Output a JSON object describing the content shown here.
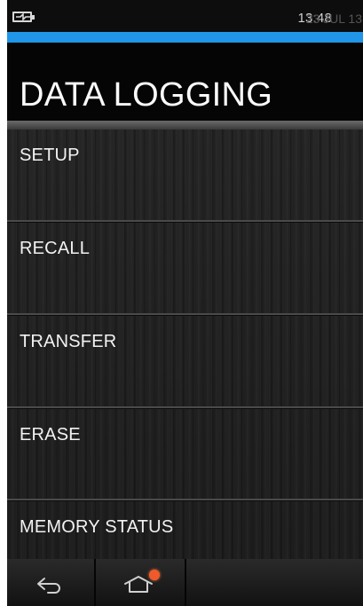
{
  "status_bar": {
    "battery_icon": "charging-battery-icon",
    "time": "13:48",
    "date": "23 JUL 13"
  },
  "colors": {
    "accent": "#2196e8",
    "notification_dot": "#f05a2a"
  },
  "page": {
    "title": "DATA LOGGING"
  },
  "menu": {
    "items": [
      {
        "label": "SETUP"
      },
      {
        "label": "RECALL"
      },
      {
        "label": "TRANSFER"
      },
      {
        "label": "ERASE"
      },
      {
        "label": "MEMORY STATUS"
      }
    ]
  },
  "nav_bar": {
    "back_icon": "back-arrow-icon",
    "home_icon": "home-icon",
    "home_badge": "notification-dot"
  }
}
